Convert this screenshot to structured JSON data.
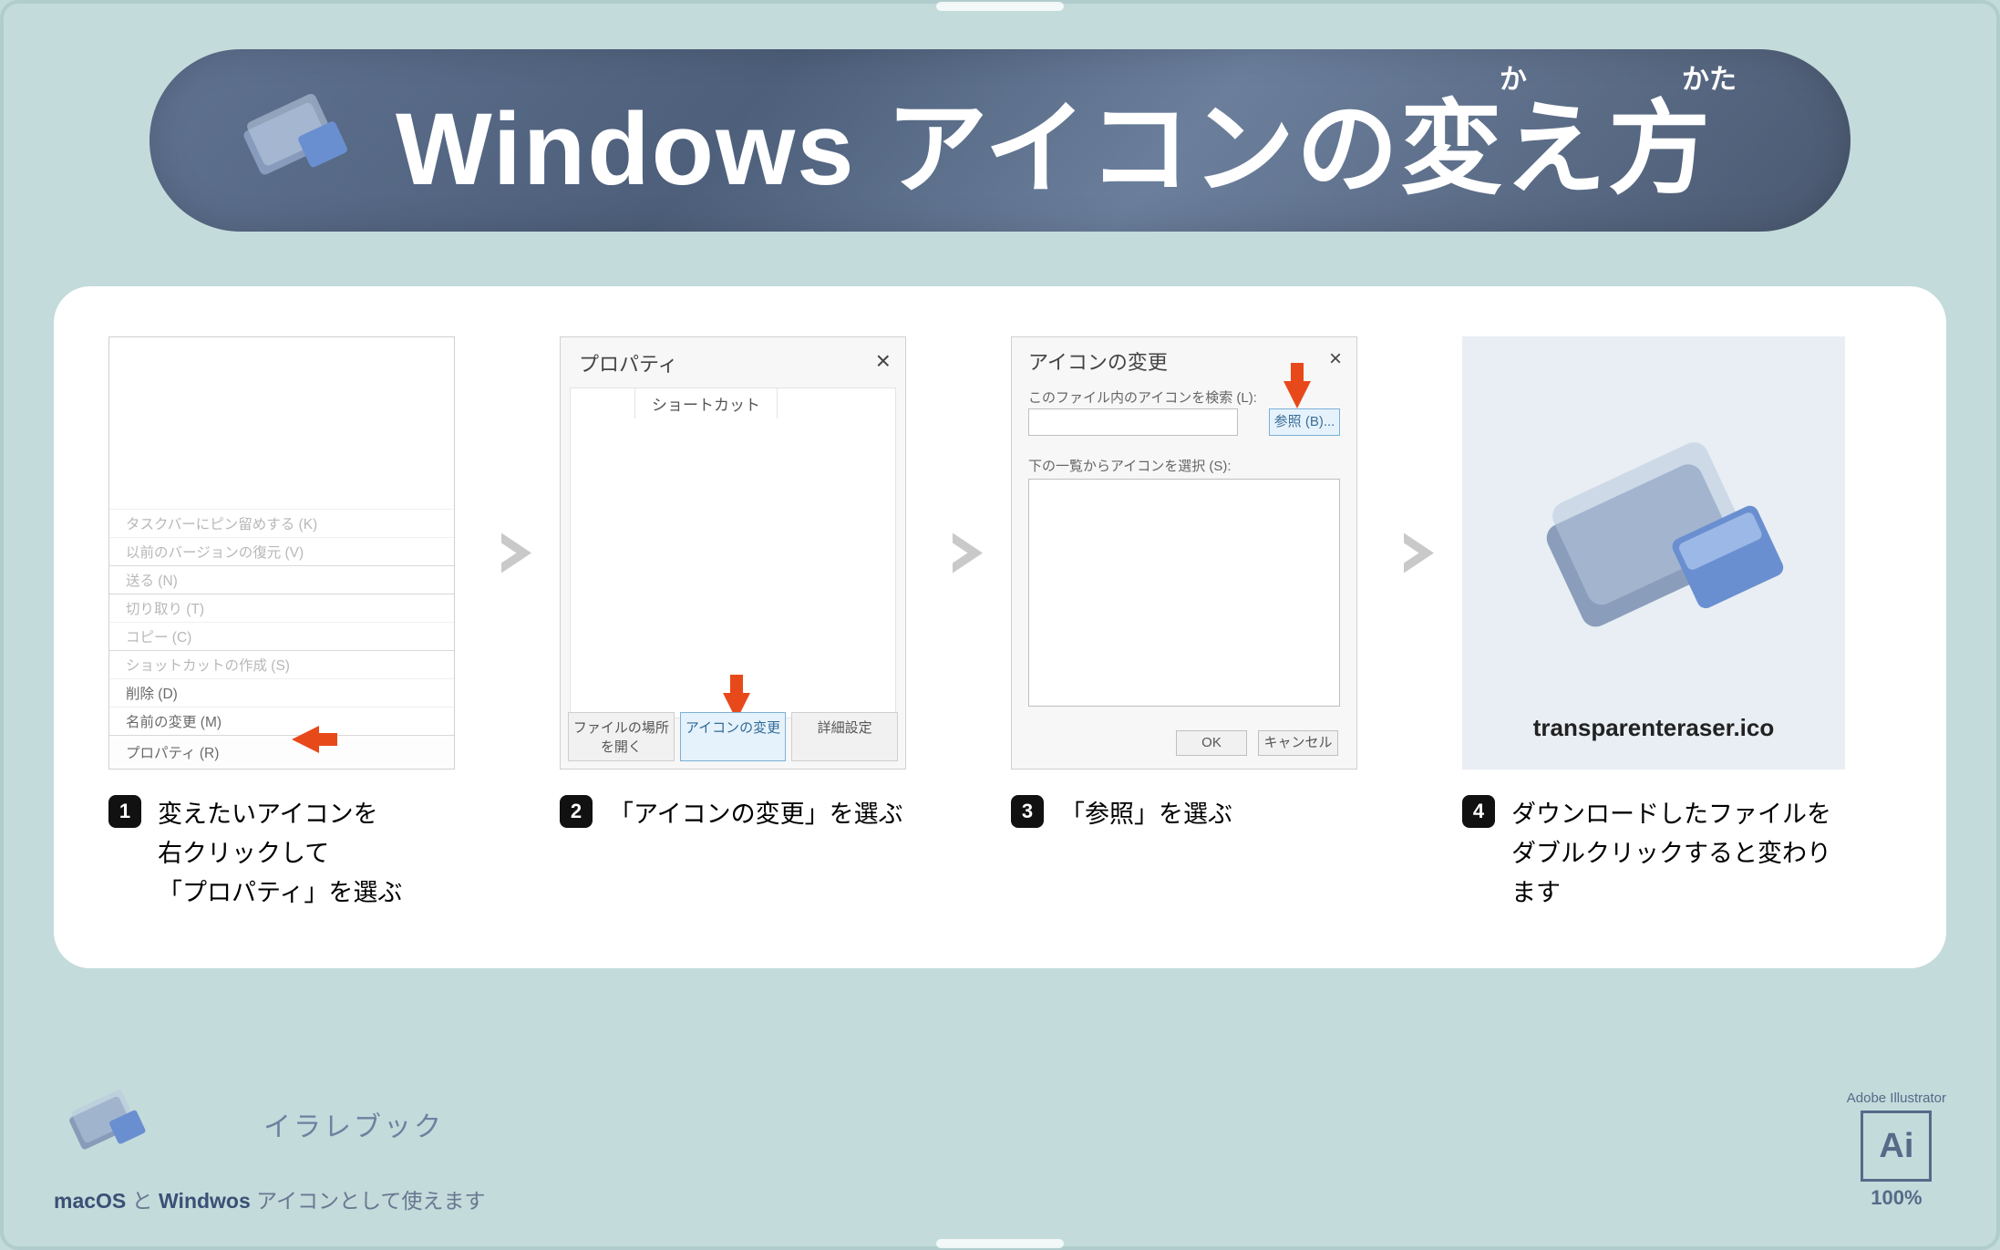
{
  "hero": {
    "title": "Windows アイコンの変え方",
    "furigana_ka": "か",
    "furigana_kata": "かた"
  },
  "steps": {
    "s1": {
      "num": "1",
      "text": "変えたいアイコンを\n右クリックして\n「プロパティ」を選ぶ",
      "menu": {
        "i0": "タスクバーにピン留めする (K)",
        "i1": "以前のバージョンの復元 (V)",
        "i2": "送る (N)",
        "i3": "切り取り (T)",
        "i4": "コピー (C)",
        "i5": "ショットカットの作成 (S)",
        "i6": "削除 (D)",
        "i7": "名前の変更 (M)",
        "i8": "プロパティ (R)"
      }
    },
    "s2": {
      "num": "2",
      "text": "「アイコンの変更」を選ぶ",
      "title": "プロパティ",
      "tab": "ショートカット",
      "btn1": "ファイルの場所を開く",
      "btn2": "アイコンの変更",
      "btn3": "詳細設定"
    },
    "s3": {
      "num": "3",
      "text": "「参照」を選ぶ",
      "title": "アイコンの変更",
      "label_search": "このファイル内のアイコンを検索 (L):",
      "browse": "参照 (B)...",
      "label_list": "下の一覧からアイコンを選択 (S):",
      "ok": "OK",
      "cancel": "キャンセル"
    },
    "s4": {
      "num": "4",
      "text": "ダウンロードしたファイルを\nダブルクリックすると変わります",
      "filename": "transparenteraser.ico"
    }
  },
  "footer": {
    "brand": "イラレブック",
    "note_prefix": "macOS",
    "note_mid": " と ",
    "note_bold": "Windwos",
    "note_suffix": " アイコンとして使えます"
  },
  "badge": {
    "top": "Adobe Illustrator",
    "ai": "Ai",
    "pct": "100%"
  }
}
